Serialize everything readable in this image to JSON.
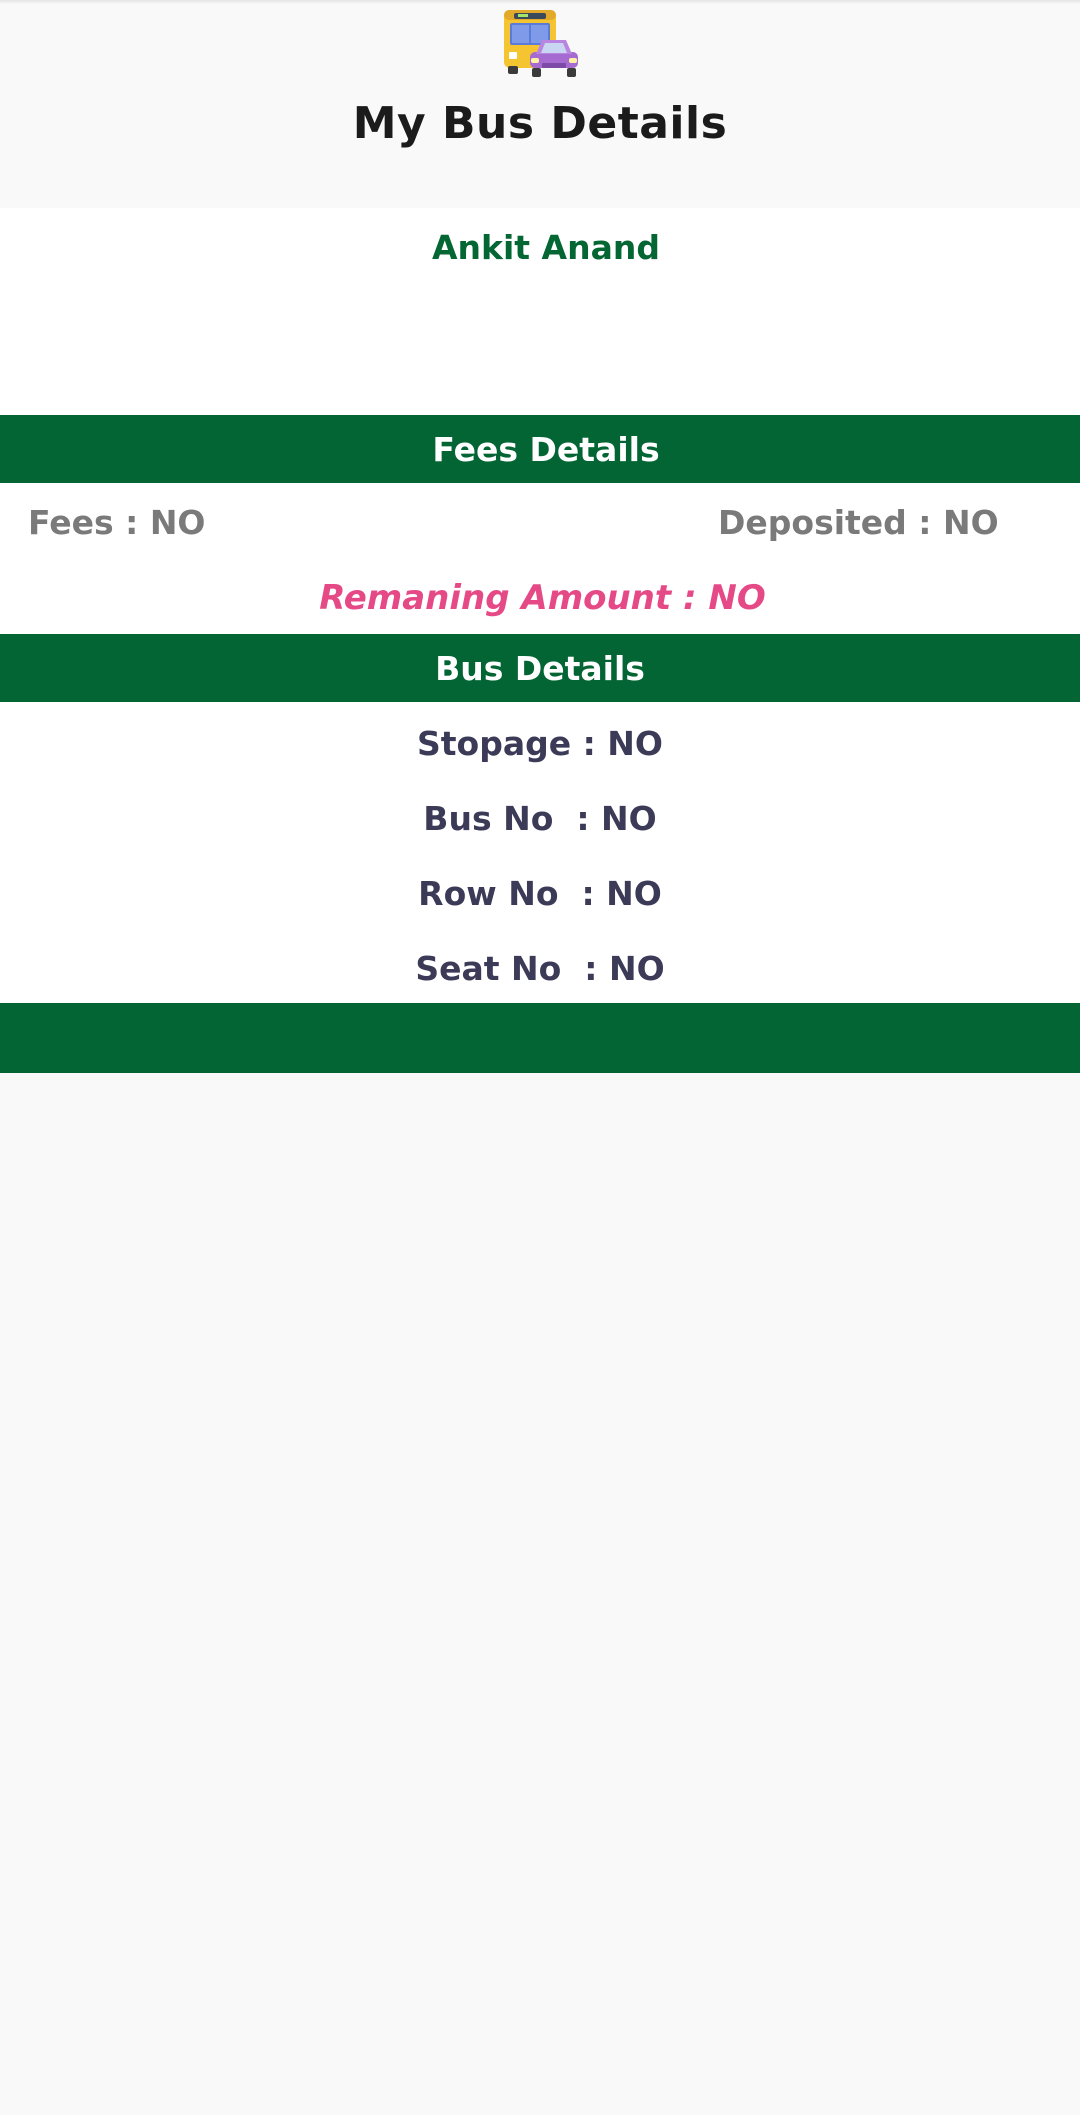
{
  "header": {
    "logo_icon": "bus-and-car-icon",
    "title": "My Bus Details"
  },
  "student": {
    "name": "Ankit Anand"
  },
  "fees": {
    "section_title": "Fees Details",
    "fees_label": "Fees",
    "fees_value": "NO",
    "deposited_label": "Deposited",
    "deposited_value": "NO",
    "remaining_text": "Remaning Amount : NO"
  },
  "bus": {
    "section_title": "Bus Details",
    "rows": [
      {
        "text": "Stopage : NO"
      },
      {
        "text": "Bus No  : NO"
      },
      {
        "text": "Row No  : NO"
      },
      {
        "text": "Seat No  : NO"
      }
    ]
  },
  "colors": {
    "primary_green": "#036534",
    "name_green": "#046633",
    "remaining_pink": "#e54a86",
    "bus_text": "#3b3a57",
    "fees_text": "#7a7a7a"
  }
}
